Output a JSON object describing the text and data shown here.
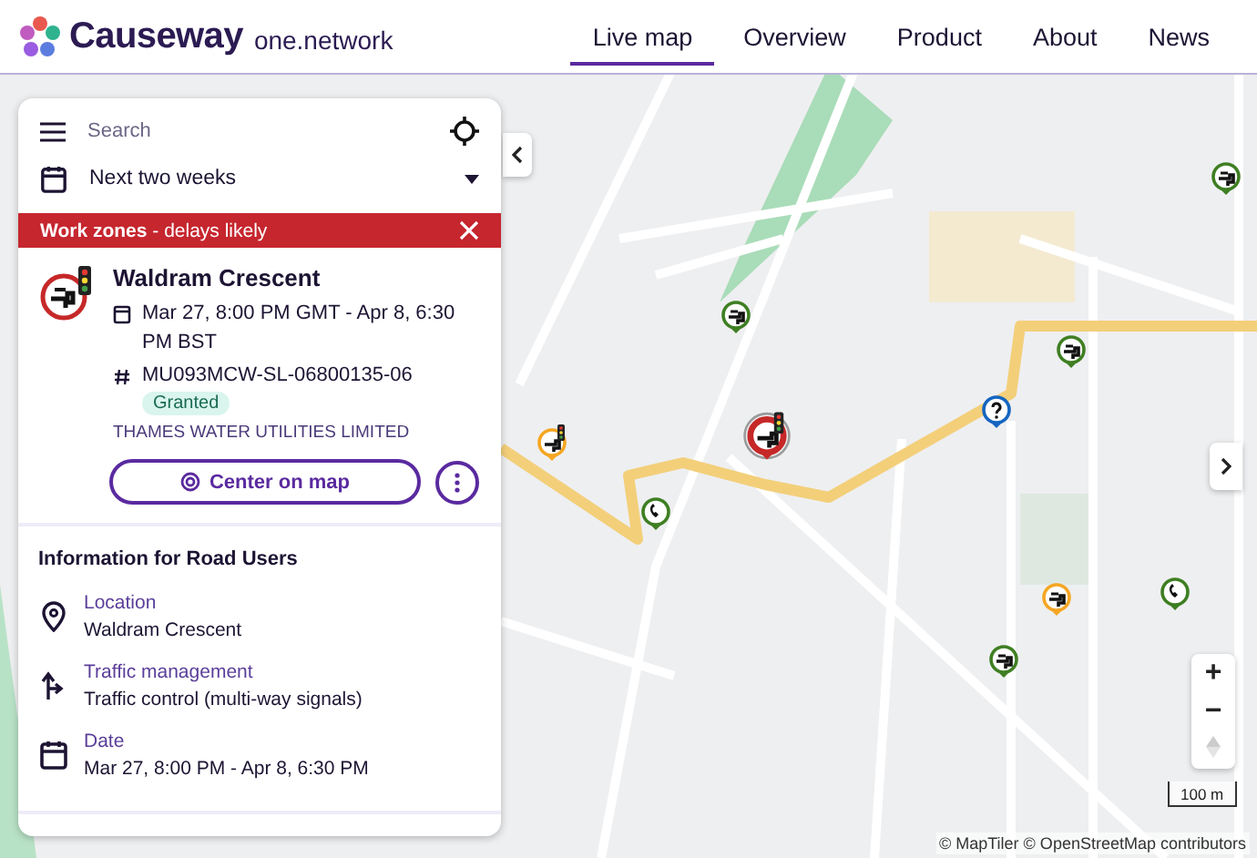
{
  "brand": {
    "name": "Causeway",
    "suffix": "one.network"
  },
  "nav": [
    {
      "label": "Live map",
      "selected": true
    },
    {
      "label": "Overview",
      "selected": false
    },
    {
      "label": "Product",
      "selected": false
    },
    {
      "label": "About",
      "selected": false
    },
    {
      "label": "News",
      "selected": false
    }
  ],
  "panel": {
    "search": {
      "placeholder": "Search"
    },
    "period": "Next two weeks",
    "banner": "**Work zones** - delays likely",
    "work": {
      "title": "Waldram Crescent",
      "dates": "Mar 27, 8:00 PM GMT - Apr 8, 6:30 PM BST",
      "reference": "MU093MCW-SL-06800135-06",
      "status": "Granted",
      "organisation": "THAMES WATER UTILITIES LIMITED",
      "action": "Center on map"
    },
    "info": {
      "heading": "Information for Road Users",
      "items": [
        {
          "kind": "location",
          "label": "Location",
          "value": "Waldram Crescent"
        },
        {
          "kind": "traffic",
          "label": "Traffic management",
          "value": "Traffic control (multi-way signals)"
        },
        {
          "kind": "date",
          "label": "Date",
          "value": "Mar 27, 8:00 PM - Apr 8, 6:30 PM"
        }
      ]
    }
  },
  "map": {
    "markers": [
      {
        "kind": "water",
        "color": "#3f7f23",
        "selected": false
      },
      {
        "kind": "signals",
        "color": "#c62828",
        "selected": true
      },
      {
        "kind": "water",
        "color": "#3f7f23",
        "selected": false
      },
      {
        "kind": "question",
        "color": "#1565c0",
        "selected": false
      },
      {
        "kind": "phone",
        "color": "#3f7f23",
        "selected": false
      },
      {
        "kind": "signals",
        "color": "#f5a623",
        "selected": false
      },
      {
        "kind": "water",
        "color": "#f5a623",
        "selected": false
      },
      {
        "kind": "phone",
        "color": "#3f7f23",
        "selected": false
      },
      {
        "kind": "water",
        "color": "#3f7f23",
        "selected": false
      },
      {
        "kind": "water",
        "color": "#3f7f23",
        "selected": false
      }
    ],
    "zoom_in": "+",
    "zoom_out": "−",
    "scale": "100 m",
    "attribution": "© MapTiler © OpenStreetMap contributors"
  }
}
